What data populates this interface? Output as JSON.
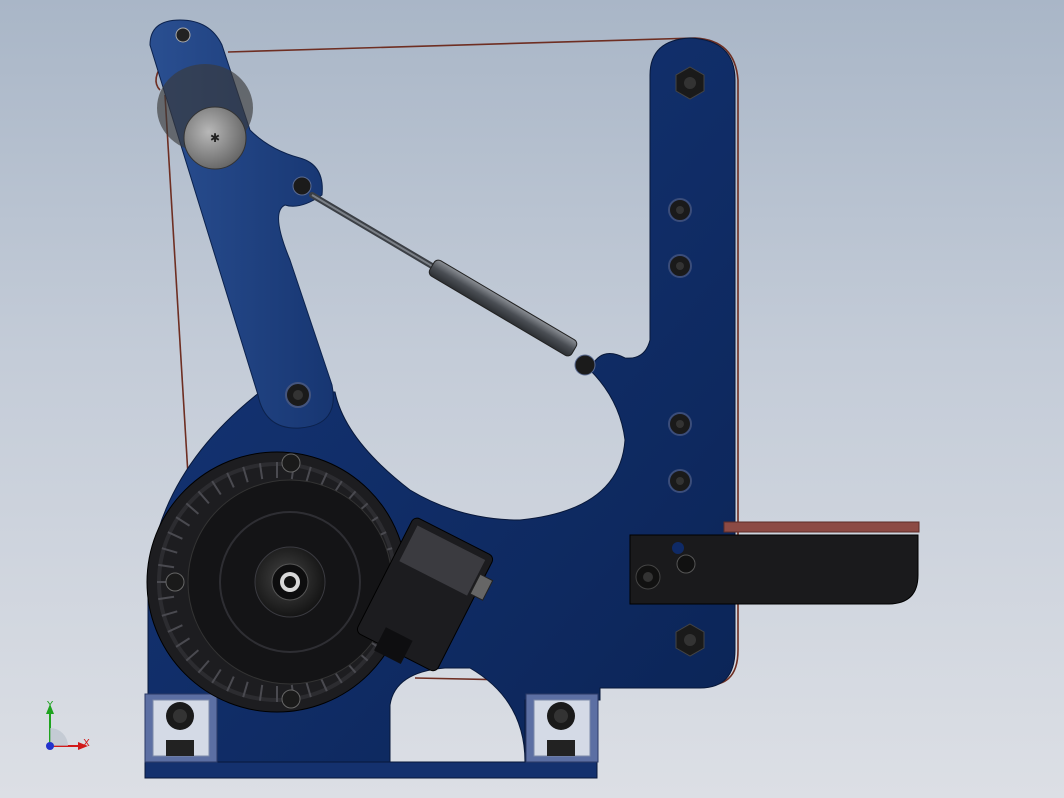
{
  "triad": {
    "x_label": "X",
    "y_label": "Y",
    "x_color": "#d11a1a",
    "y_color": "#1fa31f",
    "origin_color": "#2233cc"
  },
  "colors": {
    "frame_blue": "#0f2a66",
    "arm_blue": "#1e3f7c",
    "motor_black": "#1a1a1c",
    "belt_brown": "#7a3b2e",
    "platen_red": "#8c4a44",
    "bolt_dark": "#141414",
    "shock_gray": "#555a60"
  }
}
